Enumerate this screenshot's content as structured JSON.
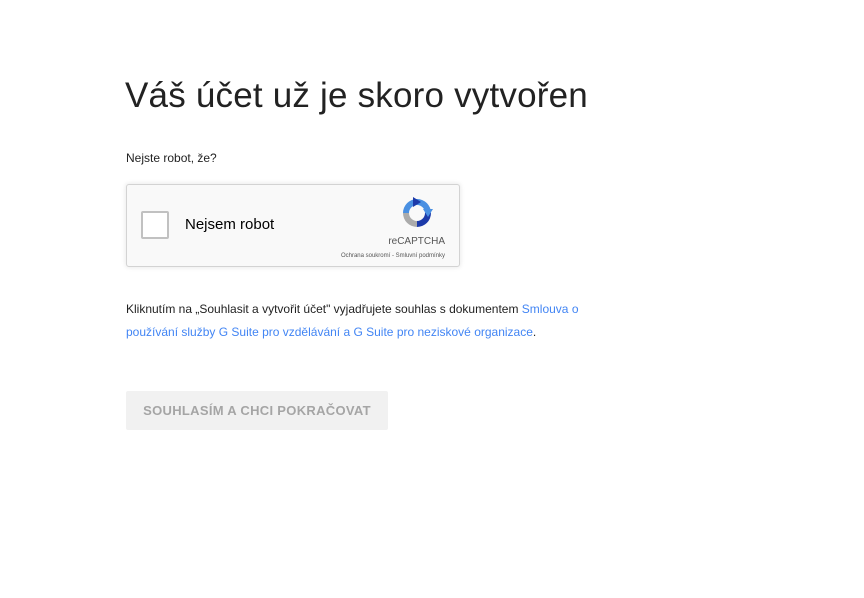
{
  "page": {
    "title": "Váš účet už je skoro vytvořen",
    "robot_question": "Nejste robot, že?"
  },
  "recaptcha": {
    "checkbox_label": "Nejsem robot",
    "brand": "reCAPTCHA",
    "legal": "Ochrana soukromí - Smluvní podmínky",
    "checked": false
  },
  "consent": {
    "text_before": "Kliknutím na „Souhlasit a vytvořit účet\" vyjadřujete souhlas s dokumentem",
    "link_text": "Smlouva o používání služby G Suite pro vzdělávání a G Suite pro neziskové organizace",
    "text_after": "."
  },
  "actions": {
    "agree_label": "SOUHLASÍM A CHCI POKRAČOVAT",
    "agree_enabled": false
  },
  "colors": {
    "link": "#4285f4",
    "disabled_button_bg": "#f1f1f1",
    "disabled_button_text": "#a5a5a5"
  },
  "icons": {
    "recaptcha_logo": "recaptcha-logo-icon"
  }
}
